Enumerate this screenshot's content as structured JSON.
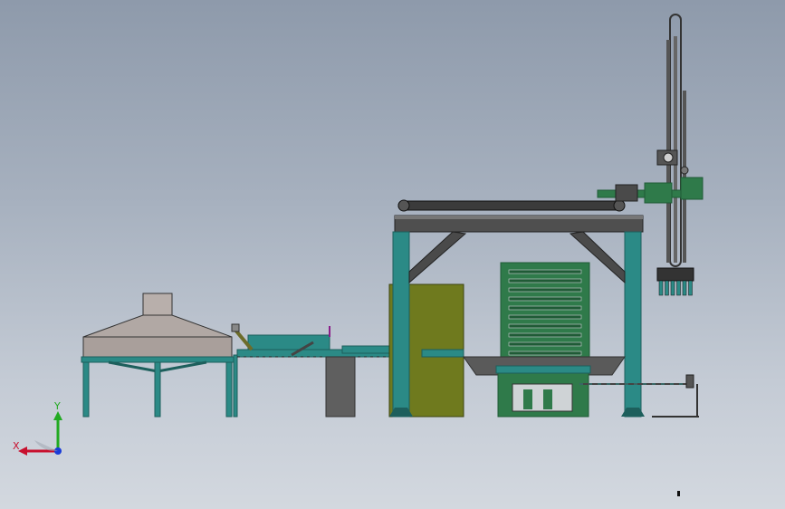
{
  "window": {
    "title": ""
  },
  "triad": {
    "x_label": "X",
    "y_label": "Y",
    "x_color": "#c8102e",
    "y_color": "#22aa22",
    "z_color": "#1a3cd8"
  },
  "colors": {
    "frame_teal": "#2b8a86",
    "frame_dark": "#1d5f5c",
    "hood_gray": "#a99f9b",
    "hood_top": "#b9b0ac",
    "olive_panel": "#6f7a1e",
    "pallet_green": "#2f7a4a",
    "pallet_dark": "#1f5b36",
    "gantry_dark": "#3b3b3b",
    "support_gray": "#5f5f5f"
  }
}
